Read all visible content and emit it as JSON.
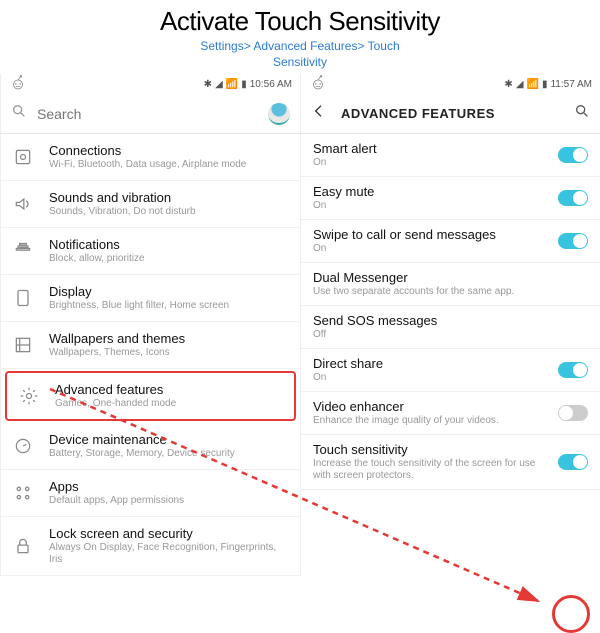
{
  "header": {
    "title": "Activate Touch Sensitivity",
    "breadcrumb_line1": "Settings> Advanced Features> Touch",
    "breadcrumb_line2": "Sensitivity"
  },
  "left": {
    "status_time": "10:56 AM",
    "search_placeholder": "Search",
    "items": [
      {
        "title": "Connections",
        "sub": "Wi-Fi, Bluetooth, Data usage, Airplane mode",
        "icon": "connections-icon"
      },
      {
        "title": "Sounds and vibration",
        "sub": "Sounds, Vibration, Do not disturb",
        "icon": "sound-icon"
      },
      {
        "title": "Notifications",
        "sub": "Block, allow, prioritize",
        "icon": "notifications-icon"
      },
      {
        "title": "Display",
        "sub": "Brightness, Blue light filter, Home screen",
        "icon": "display-icon"
      },
      {
        "title": "Wallpapers and themes",
        "sub": "Wallpapers, Themes, Icons",
        "icon": "wallpaper-icon"
      },
      {
        "title": "Advanced features",
        "sub": "Games, One-handed mode",
        "icon": "advanced-icon",
        "highlighted": true
      },
      {
        "title": "Device maintenance",
        "sub": "Battery, Storage, Memory, Device security",
        "icon": "maintenance-icon"
      },
      {
        "title": "Apps",
        "sub": "Default apps, App permissions",
        "icon": "apps-icon"
      },
      {
        "title": "Lock screen and security",
        "sub": "Always On Display, Face Recognition, Fingerprints, Iris",
        "icon": "lock-icon"
      }
    ]
  },
  "right": {
    "status_time": "11:57 AM",
    "header_title": "ADVANCED FEATURES",
    "items": [
      {
        "title": "Smart alert",
        "sub": "On",
        "toggle": "on"
      },
      {
        "title": "Easy mute",
        "sub": "On",
        "toggle": "on"
      },
      {
        "title": "Swipe to call or send messages",
        "sub": "On",
        "toggle": "on"
      },
      {
        "title": "Dual Messenger",
        "sub": "Use two separate accounts for the same app."
      },
      {
        "title": "Send SOS messages",
        "sub": "Off"
      },
      {
        "title": "Direct share",
        "sub": "On",
        "toggle": "on"
      },
      {
        "title": "Video enhancer",
        "sub": "Enhance the image quality of your videos.",
        "toggle": "off"
      },
      {
        "title": "Touch sensitivity",
        "sub": "Increase the touch sensitivity of the screen for use with screen protectors.",
        "toggle": "on",
        "circled": true
      }
    ]
  }
}
